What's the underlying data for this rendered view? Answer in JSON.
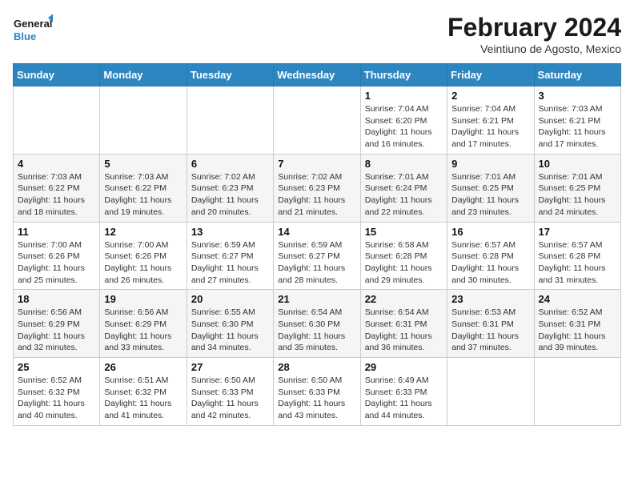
{
  "logo": {
    "line1": "General",
    "line2": "Blue"
  },
  "title": "February 2024",
  "subtitle": "Veintiuno de Agosto, Mexico",
  "weekdays": [
    "Sunday",
    "Monday",
    "Tuesday",
    "Wednesday",
    "Thursday",
    "Friday",
    "Saturday"
  ],
  "weeks": [
    [
      {
        "day": "",
        "info": ""
      },
      {
        "day": "",
        "info": ""
      },
      {
        "day": "",
        "info": ""
      },
      {
        "day": "",
        "info": ""
      },
      {
        "day": "1",
        "info": "Sunrise: 7:04 AM\nSunset: 6:20 PM\nDaylight: 11 hours and 16 minutes."
      },
      {
        "day": "2",
        "info": "Sunrise: 7:04 AM\nSunset: 6:21 PM\nDaylight: 11 hours and 17 minutes."
      },
      {
        "day": "3",
        "info": "Sunrise: 7:03 AM\nSunset: 6:21 PM\nDaylight: 11 hours and 17 minutes."
      }
    ],
    [
      {
        "day": "4",
        "info": "Sunrise: 7:03 AM\nSunset: 6:22 PM\nDaylight: 11 hours and 18 minutes."
      },
      {
        "day": "5",
        "info": "Sunrise: 7:03 AM\nSunset: 6:22 PM\nDaylight: 11 hours and 19 minutes."
      },
      {
        "day": "6",
        "info": "Sunrise: 7:02 AM\nSunset: 6:23 PM\nDaylight: 11 hours and 20 minutes."
      },
      {
        "day": "7",
        "info": "Sunrise: 7:02 AM\nSunset: 6:23 PM\nDaylight: 11 hours and 21 minutes."
      },
      {
        "day": "8",
        "info": "Sunrise: 7:01 AM\nSunset: 6:24 PM\nDaylight: 11 hours and 22 minutes."
      },
      {
        "day": "9",
        "info": "Sunrise: 7:01 AM\nSunset: 6:25 PM\nDaylight: 11 hours and 23 minutes."
      },
      {
        "day": "10",
        "info": "Sunrise: 7:01 AM\nSunset: 6:25 PM\nDaylight: 11 hours and 24 minutes."
      }
    ],
    [
      {
        "day": "11",
        "info": "Sunrise: 7:00 AM\nSunset: 6:26 PM\nDaylight: 11 hours and 25 minutes."
      },
      {
        "day": "12",
        "info": "Sunrise: 7:00 AM\nSunset: 6:26 PM\nDaylight: 11 hours and 26 minutes."
      },
      {
        "day": "13",
        "info": "Sunrise: 6:59 AM\nSunset: 6:27 PM\nDaylight: 11 hours and 27 minutes."
      },
      {
        "day": "14",
        "info": "Sunrise: 6:59 AM\nSunset: 6:27 PM\nDaylight: 11 hours and 28 minutes."
      },
      {
        "day": "15",
        "info": "Sunrise: 6:58 AM\nSunset: 6:28 PM\nDaylight: 11 hours and 29 minutes."
      },
      {
        "day": "16",
        "info": "Sunrise: 6:57 AM\nSunset: 6:28 PM\nDaylight: 11 hours and 30 minutes."
      },
      {
        "day": "17",
        "info": "Sunrise: 6:57 AM\nSunset: 6:28 PM\nDaylight: 11 hours and 31 minutes."
      }
    ],
    [
      {
        "day": "18",
        "info": "Sunrise: 6:56 AM\nSunset: 6:29 PM\nDaylight: 11 hours and 32 minutes."
      },
      {
        "day": "19",
        "info": "Sunrise: 6:56 AM\nSunset: 6:29 PM\nDaylight: 11 hours and 33 minutes."
      },
      {
        "day": "20",
        "info": "Sunrise: 6:55 AM\nSunset: 6:30 PM\nDaylight: 11 hours and 34 minutes."
      },
      {
        "day": "21",
        "info": "Sunrise: 6:54 AM\nSunset: 6:30 PM\nDaylight: 11 hours and 35 minutes."
      },
      {
        "day": "22",
        "info": "Sunrise: 6:54 AM\nSunset: 6:31 PM\nDaylight: 11 hours and 36 minutes."
      },
      {
        "day": "23",
        "info": "Sunrise: 6:53 AM\nSunset: 6:31 PM\nDaylight: 11 hours and 37 minutes."
      },
      {
        "day": "24",
        "info": "Sunrise: 6:52 AM\nSunset: 6:31 PM\nDaylight: 11 hours and 39 minutes."
      }
    ],
    [
      {
        "day": "25",
        "info": "Sunrise: 6:52 AM\nSunset: 6:32 PM\nDaylight: 11 hours and 40 minutes."
      },
      {
        "day": "26",
        "info": "Sunrise: 6:51 AM\nSunset: 6:32 PM\nDaylight: 11 hours and 41 minutes."
      },
      {
        "day": "27",
        "info": "Sunrise: 6:50 AM\nSunset: 6:33 PM\nDaylight: 11 hours and 42 minutes."
      },
      {
        "day": "28",
        "info": "Sunrise: 6:50 AM\nSunset: 6:33 PM\nDaylight: 11 hours and 43 minutes."
      },
      {
        "day": "29",
        "info": "Sunrise: 6:49 AM\nSunset: 6:33 PM\nDaylight: 11 hours and 44 minutes."
      },
      {
        "day": "",
        "info": ""
      },
      {
        "day": "",
        "info": ""
      }
    ]
  ]
}
